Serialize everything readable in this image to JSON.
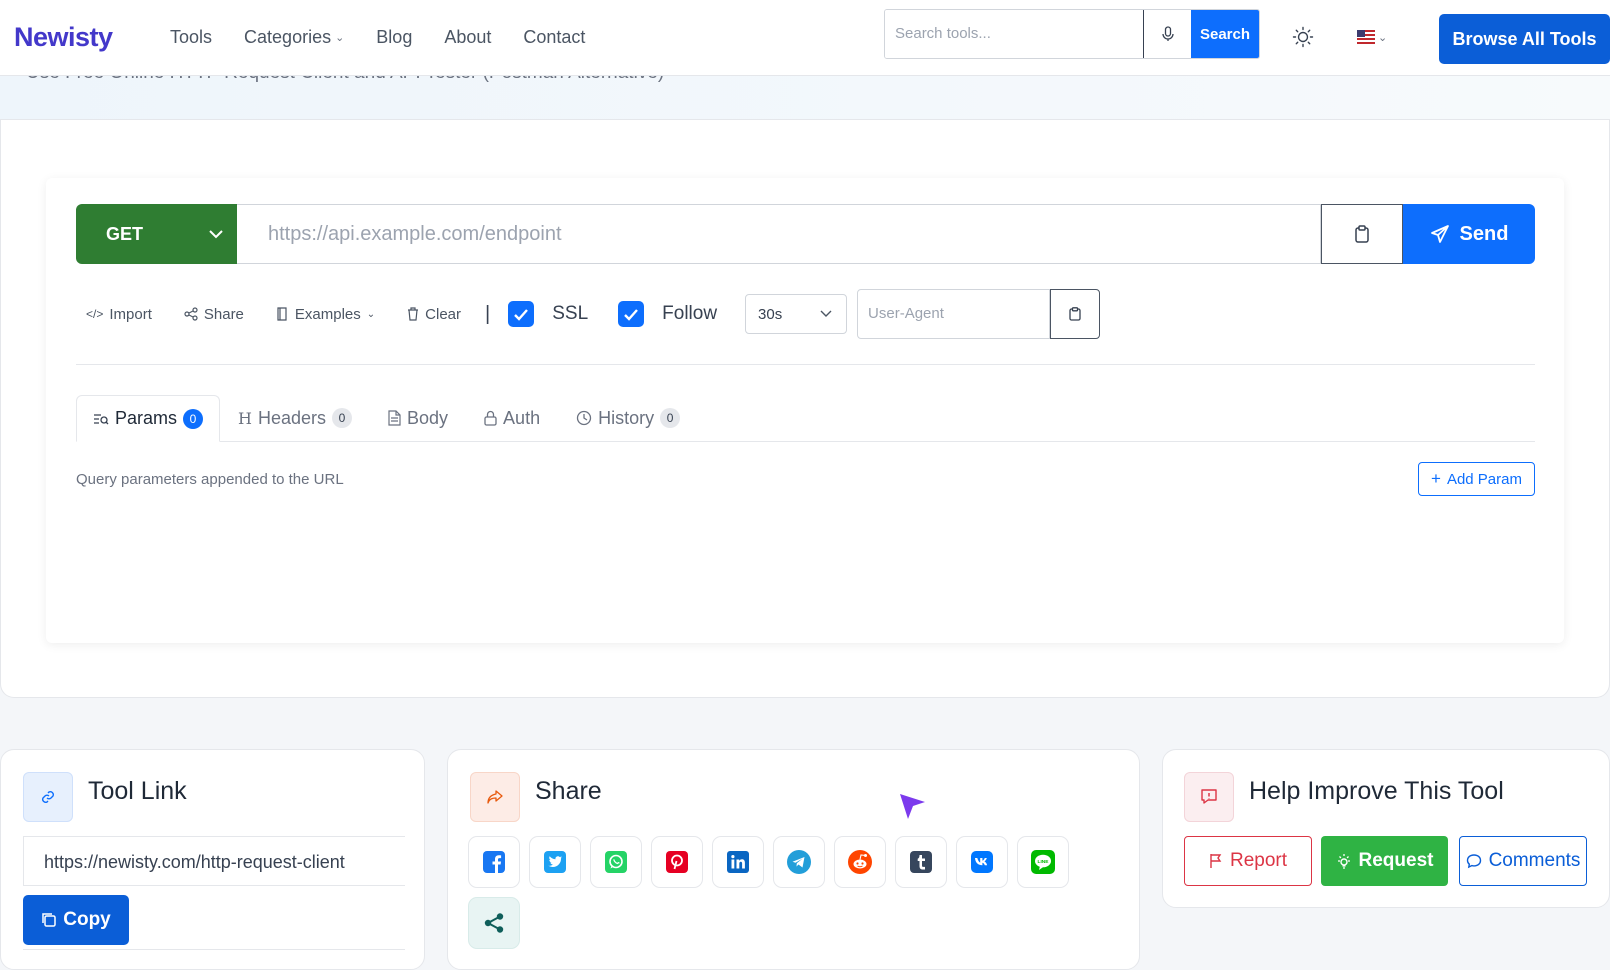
{
  "brand": "Newisty",
  "nav": [
    {
      "label": "Tools",
      "dropdown": false
    },
    {
      "label": "Categories",
      "dropdown": true
    },
    {
      "label": "Blog",
      "dropdown": false
    },
    {
      "label": "About",
      "dropdown": false
    },
    {
      "label": "Contact",
      "dropdown": false
    }
  ],
  "search": {
    "placeholder": "Search tools...",
    "button": "Search"
  },
  "browse_all": "Browse All Tools",
  "page_heading": "Use Free Online HTTP Request Client and API Tester (Postman Alternative)",
  "request": {
    "method": "GET",
    "url_placeholder": "https://api.example.com/endpoint",
    "send": "Send"
  },
  "toolbar": {
    "import": "Import",
    "share": "Share",
    "examples": "Examples",
    "clear": "Clear",
    "separator": "|",
    "ssl": {
      "label": "SSL",
      "checked": true
    },
    "follow": {
      "label": "Follow",
      "checked": true
    },
    "timeout": "30s",
    "user_agent_placeholder": "User-Agent"
  },
  "tabs": [
    {
      "label": "Params",
      "badge": "0",
      "active": true
    },
    {
      "label": "Headers",
      "badge": "0",
      "active": false
    },
    {
      "label": "Body",
      "badge": null,
      "active": false
    },
    {
      "label": "Auth",
      "badge": null,
      "active": false
    },
    {
      "label": "History",
      "badge": "0",
      "active": false
    }
  ],
  "params": {
    "description": "Query parameters appended to the URL",
    "add_button": "Add Param"
  },
  "tool_link": {
    "title": "Tool Link",
    "url": "https://newisty.com/http-request-client",
    "copy": "Copy"
  },
  "share_card": {
    "title": "Share",
    "networks": [
      "facebook",
      "twitter",
      "whatsapp",
      "pinterest",
      "linkedin",
      "telegram",
      "reddit",
      "tumblr",
      "vk",
      "line",
      "share"
    ]
  },
  "help": {
    "title": "Help Improve This Tool",
    "report": "Report",
    "request": "Request",
    "comments": "Comments"
  },
  "colors": {
    "primary": "#0d6efd",
    "brand": "#4338ca",
    "method_green": "#2f7d32",
    "request_green": "#2fb344",
    "report_red": "#dc3545"
  }
}
